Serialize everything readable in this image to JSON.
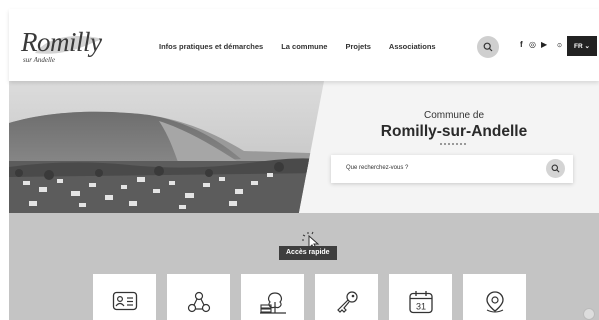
{
  "header": {
    "logo_main": "Romilly",
    "logo_sub": "sur Andelle",
    "nav": [
      "Infos pratiques et démarches",
      "La commune",
      "Projets",
      "Associations"
    ],
    "social": [
      "f",
      "◎",
      "▶"
    ],
    "lang_label": "FR ⌄"
  },
  "hero": {
    "kicker": "Commune de",
    "title": "Romilly-sur-Andelle",
    "search_placeholder": "Que recherchez-vous ?"
  },
  "quick_access": {
    "label": "Accès rapide",
    "cards": [
      {
        "icon": "id-card-icon"
      },
      {
        "icon": "community-icon"
      },
      {
        "icon": "park-icon"
      },
      {
        "icon": "keys-icon"
      },
      {
        "icon": "calendar-icon",
        "text": "31"
      },
      {
        "icon": "map-pin-icon"
      }
    ]
  },
  "colors": {
    "header_bg": "#ffffff",
    "band_bg": "#c4c4c4",
    "badge_bg": "#3e3e3e",
    "lang_bg": "#222222"
  }
}
